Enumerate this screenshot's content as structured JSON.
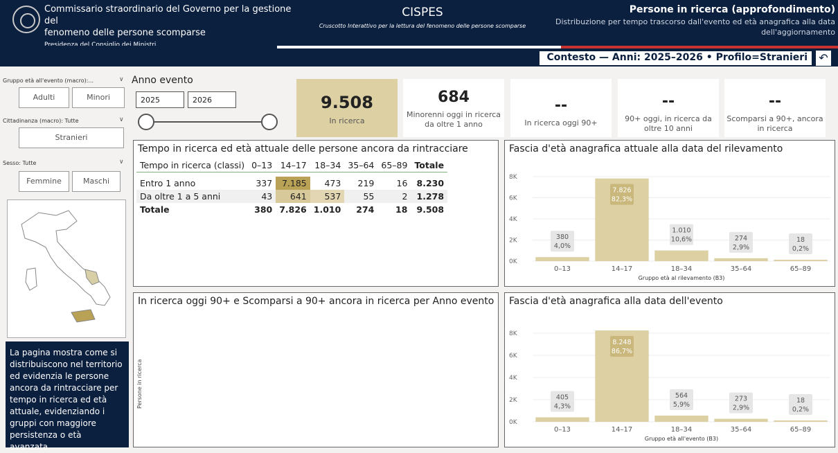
{
  "header": {
    "org_line1": "Commissario straordinario del Governo per la gestione del",
    "org_line2": "fenomeno delle persone scomparse",
    "org_sub": "Presidenza del Consiglio dei Ministri",
    "app_title": "CISPES",
    "app_subtitle": "Cruscotto Interattivo per la lettura del fenomeno delle persone scomparse",
    "page_title": "Persone in ricerca (approfondimento)",
    "page_subtitle": "Distribuzione per tempo trascorso dall'evento ed età anagrafica alla data dell'aggiornamento",
    "context": "Contesto — Anni: 2025–2026 • Profilo=Stranieri",
    "back_icon": "back-arrow-icon"
  },
  "colors": {
    "navy": "#0b1f3f",
    "tan": "#ddd0a3",
    "heat_high": "#b9a155",
    "heat_mid": "#d8c99a",
    "flag_green": "#2f7d3a",
    "flag_red": "#c8322f"
  },
  "filters": {
    "age_label": "Gruppo età all'evento (macro):...",
    "age_options": [
      "Adulti",
      "Minori"
    ],
    "cit_label": "Cittadinanza (macro): Tutte",
    "cit_options": [
      "Stranieri"
    ],
    "sex_label": "Sesso: Tutte",
    "sex_options": [
      "Femmine",
      "Maschi"
    ]
  },
  "description": "La pagina mostra come si distribuiscono nel territorio ed evidenzia le persone ancora da rintracciare per tempo in ricerca ed età attuale, evidenziando i gruppi con maggiore persistenza o età avanzata.",
  "year": {
    "label": "Anno evento",
    "from": "2025",
    "to": "2026"
  },
  "kpis": [
    {
      "value": "9.508",
      "label": "In ricerca"
    },
    {
      "value": "684",
      "label": "Minorenni oggi in ricerca da oltre 1 anno"
    },
    {
      "value": "--",
      "label": "In ricerca oggi 90+"
    },
    {
      "value": "--",
      "label": "90+ oggi, in ricerca da oltre 10 anni"
    },
    {
      "value": "--",
      "label": "Scomparsi a 90+, ancora in ricerca"
    }
  ],
  "table": {
    "title": "Tempo in ricerca ed età attuale delle persone ancora da rintracciare",
    "headers": [
      "Tempo in ricerca (classi)",
      "0–13",
      "14–17",
      "18–34",
      "35–64",
      "65–89",
      "Totale"
    ],
    "rows": [
      [
        "Entro 1 anno",
        "337",
        "7.185",
        "473",
        "219",
        "16",
        "8.230"
      ],
      [
        "Da oltre 1 a 5 anni",
        "43",
        "641",
        "537",
        "55",
        "2",
        "1.278"
      ],
      [
        "Totale",
        "380",
        "7.826",
        "1.010",
        "274",
        "18",
        "9.508"
      ]
    ]
  },
  "empty_chart": {
    "title": "In ricerca oggi 90+ e Scomparsi a 90+ ancora in ricerca per Anno evento",
    "ylabel": "Persone in ricerca"
  },
  "chart_data": [
    {
      "type": "bar",
      "title": "Fascia d'età anagrafica attuale alla data del rilevamento",
      "xlabel": "Gruppo età al rilevamento (B3)",
      "ylabel": "",
      "categories": [
        "0–13",
        "14–17",
        "18–34",
        "35–64",
        "65–89"
      ],
      "values": [
        380,
        7826,
        1010,
        274,
        18
      ],
      "data_labels": [
        [
          "380",
          "4,0%"
        ],
        [
          "7.826",
          "82,3%"
        ],
        [
          "1.010",
          "10,6%"
        ],
        [
          "274",
          "2,9%"
        ],
        [
          "18",
          "0,2%"
        ]
      ],
      "yticks": [
        "8K",
        "6K",
        "4K",
        "2K",
        "0K"
      ],
      "ylim": [
        0,
        8000
      ]
    },
    {
      "type": "bar",
      "title": "Fascia d'età anagrafica alla data dell'evento",
      "xlabel": "Gruppo età all'evento (B3)",
      "ylabel": "",
      "categories": [
        "0–13",
        "14–17",
        "18–34",
        "35–64",
        "65–89"
      ],
      "values": [
        405,
        8248,
        564,
        273,
        18
      ],
      "data_labels": [
        [
          "405",
          "4,3%"
        ],
        [
          "8.248",
          "86,7%"
        ],
        [
          "564",
          "5,9%"
        ],
        [
          "273",
          "2,9%"
        ],
        [
          "18",
          "0,2%"
        ]
      ],
      "yticks": [
        "8K",
        "6K",
        "4K",
        "2K",
        "0K"
      ],
      "ylim": [
        0,
        8000
      ]
    }
  ]
}
